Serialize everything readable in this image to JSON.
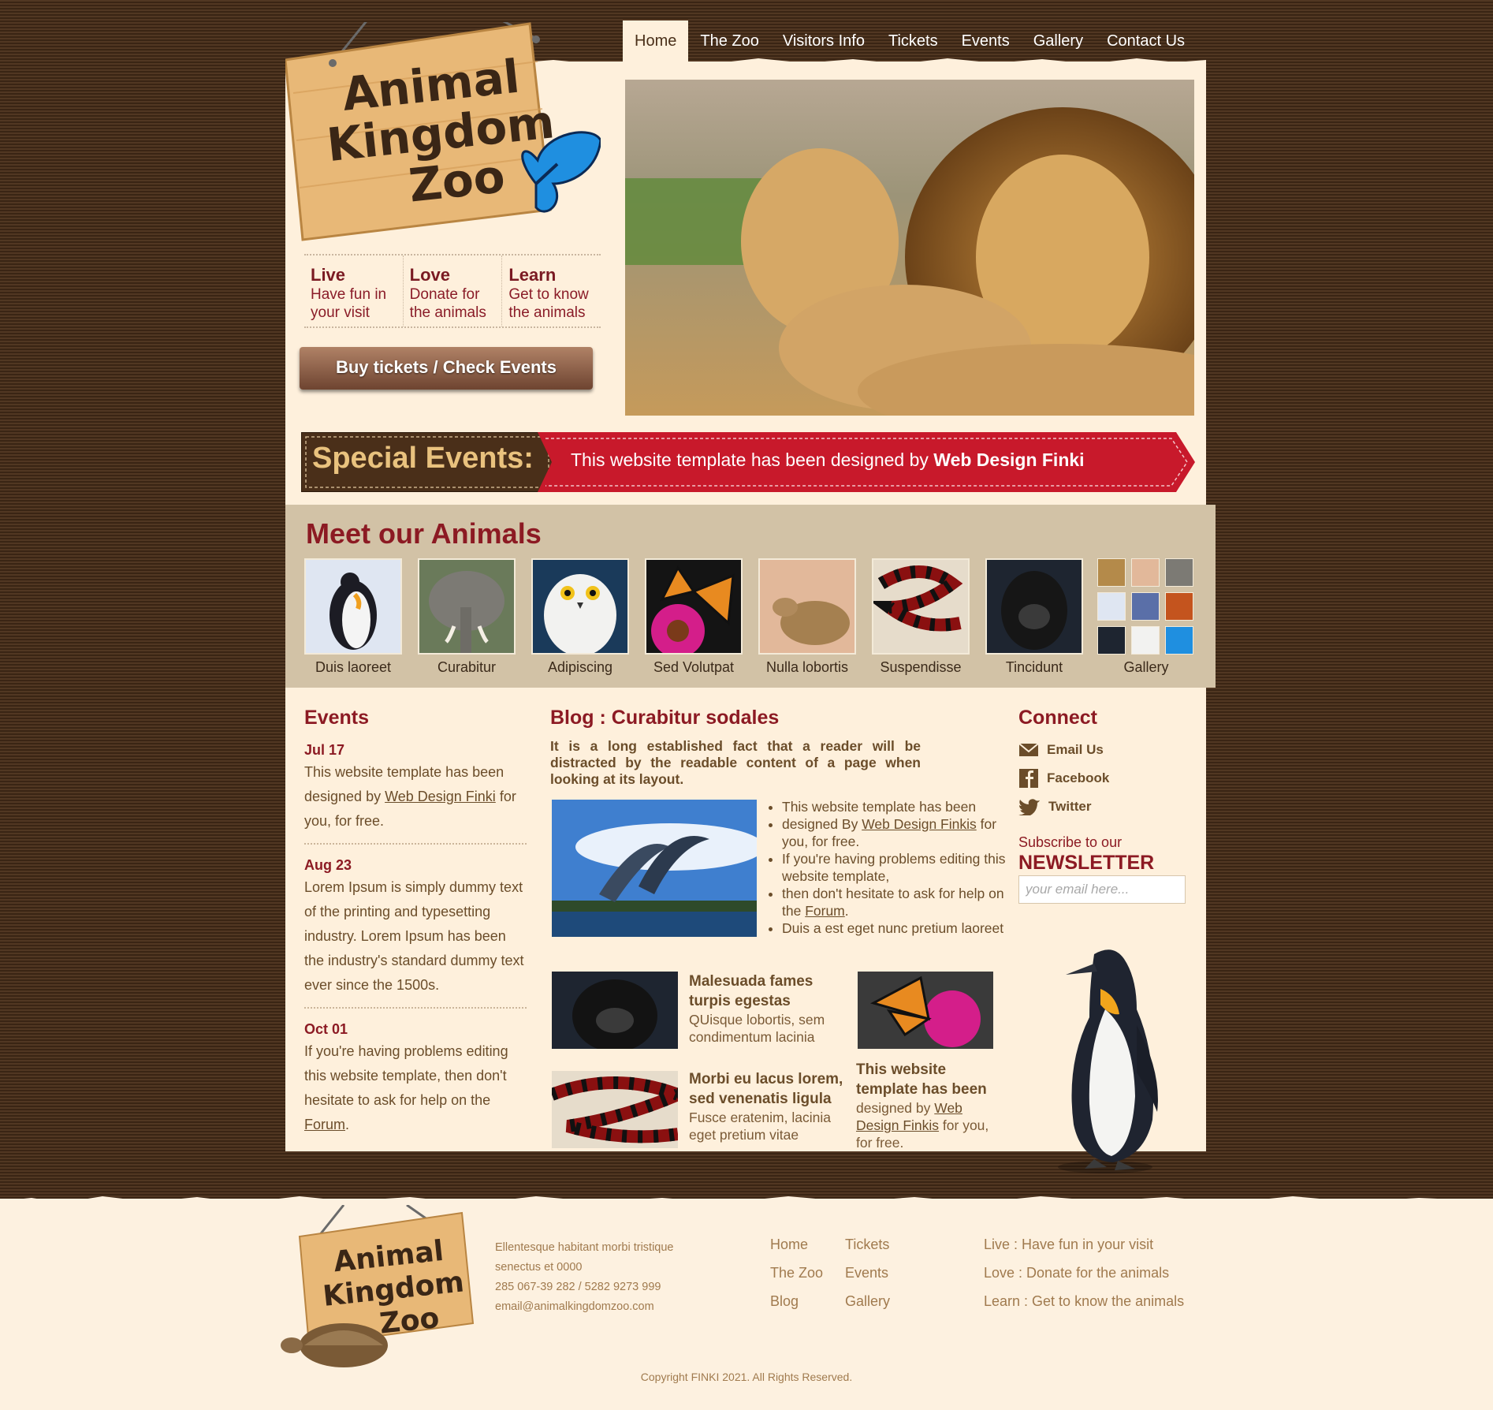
{
  "nav": [
    "Home",
    "The Zoo",
    "Visitors Info",
    "Tickets",
    "Events",
    "Gallery",
    "Contact Us"
  ],
  "logo": {
    "line1": "Animal",
    "line2": "Kingdom",
    "line3": "Zoo"
  },
  "taglines": [
    {
      "title": "Live",
      "text": "Have fun in your visit"
    },
    {
      "title": "Love",
      "text": "Donate for the animals"
    },
    {
      "title": "Learn",
      "text": "Get to know the animals"
    }
  ],
  "buy_button": "Buy tickets / Check Events",
  "special": {
    "label": "Special Events:",
    "text": "This website template has been designed by ",
    "strong": "Web Design Finki"
  },
  "meet": {
    "title": "Meet our Animals",
    "animals": [
      "Duis laoreet",
      "Curabitur",
      "Adipiscing",
      "Sed Volutpat",
      "Nulla lobortis",
      "Suspendisse",
      "Tincidunt"
    ],
    "gallery": "Gallery"
  },
  "events": {
    "title": "Events",
    "items": [
      {
        "date": "Jul 17",
        "pre": "This website template has been designed by ",
        "link": "Web Design Finki",
        "post": " for you, for free."
      },
      {
        "date": "Aug 23",
        "pre": "Lorem Ipsum is simply dummy text of the printing and typesetting industry. Lorem Ipsum has been the industry's standard dummy text ever since the 1500s.",
        "link": "",
        "post": ""
      },
      {
        "date": "Oct 01",
        "pre": "If you're having problems editing this website template, then don't hesitate to ask for help on the ",
        "link": "Forum",
        "post": "."
      }
    ]
  },
  "blog": {
    "title": "Blog : Curabitur sodales",
    "intro": "It is a long established fact that a reader will be distracted by the readable content of a page when looking at its layout.",
    "list": [
      {
        "pre": "This website template has been",
        "link": "",
        "post": ""
      },
      {
        "pre": "designed By ",
        "link": "Web Design Finkis",
        "post": " for you, for free."
      },
      {
        "pre": "If you're having problems editing this website template,",
        "link": "",
        "post": ""
      },
      {
        "pre": "then don't hesitate to ask for help on the ",
        "link": "Forum",
        "post": "."
      },
      {
        "pre": "Duis a est eget nunc pretium laoreet",
        "link": "",
        "post": ""
      }
    ],
    "posts": [
      {
        "title": "Malesuada fames turpis egestas",
        "text": "QUisque lobortis, sem condimentum lacinia"
      },
      {
        "title": "Morbi eu lacus lorem, sed venenatis ligula",
        "text": "Fusce eratenim, lacinia eget pretium vitae"
      },
      {
        "title": "This website template has been",
        "pre": "designed by ",
        "link": "Web Design Finkis",
        "post": " for you, for free."
      }
    ]
  },
  "connect": {
    "title": "Connect",
    "items": [
      "Email Us",
      "Facebook",
      "Twitter"
    ],
    "subscribe": "Subscribe to our",
    "newsletter": "NEWSLETTER",
    "placeholder": "your email here..."
  },
  "footer": {
    "address": [
      "Ellentesque habitant morbi tristique",
      "senectus et 0000",
      "285 067-39 282 / 5282 9273 999",
      "email@animalkingdomzoo.com"
    ],
    "links_col1": [
      "Home",
      "The Zoo",
      "Blog"
    ],
    "links_col2": [
      "Tickets",
      "Events",
      "Gallery"
    ],
    "links_col3": [
      "Live : Have fun in your visit",
      "Love : Donate for the animals",
      "Learn : Get to know the animals"
    ],
    "copyright": "Copyright FINKI 2021. All Rights Reserved."
  },
  "colors": {
    "accent": "#8c1a23",
    "background": "#4a2f19",
    "paper": "#fef0dc",
    "ribbon": "#c8192b",
    "text": "#6b4d2a"
  }
}
